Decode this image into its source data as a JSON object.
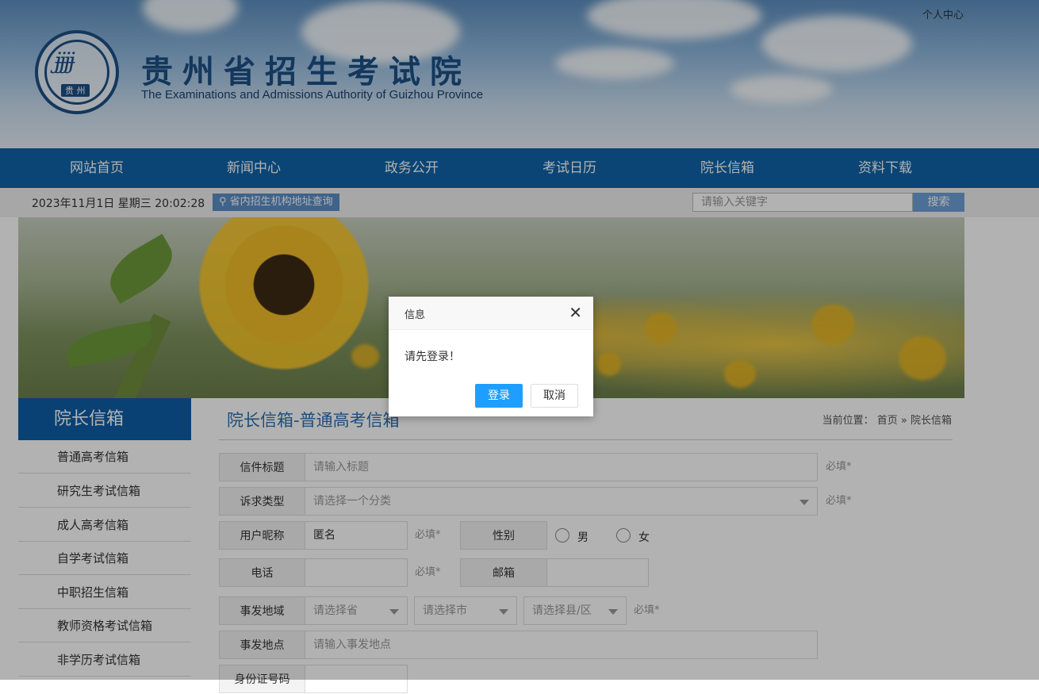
{
  "header": {
    "user_center": "个人中心",
    "site_title": "贵州省招生考试院",
    "site_subtitle": "The Examinations and Admissions Authority of Guizhou Province",
    "logo_text": "贵 州"
  },
  "nav": {
    "items": [
      "网站首页",
      "新闻中心",
      "政务公开",
      "考试日历",
      "院长信箱",
      "资料下载"
    ]
  },
  "infobar": {
    "datetime": "2023年11月1日 星期三 20:02:28",
    "addr_link": "省内招生机构地址查询",
    "search_placeholder": "请输入关键字",
    "search_button": "搜索"
  },
  "sidebar": {
    "heading": "院长信箱",
    "items": [
      "普通高考信箱",
      "研究生考试信箱",
      "成人高考信箱",
      "自学考试信箱",
      "中职招生信箱",
      "教师资格考试信箱",
      "非学历考试信箱"
    ]
  },
  "content": {
    "page_title": "院长信箱-普通高考信箱",
    "breadcrumb": "当前位置： 首页 » 院长信箱",
    "form": {
      "title_label": "信件标题",
      "title_placeholder": "请输入标题",
      "type_label": "诉求类型",
      "type_placeholder": "请选择一个分类",
      "nickname_label": "用户昵称",
      "nickname_value": "匿名",
      "gender_label": "性别",
      "gender_male": "男",
      "gender_female": "女",
      "phone_label": "电话",
      "email_label": "邮箱",
      "region_label": "事发地域",
      "province_placeholder": "请选择省",
      "city_placeholder": "请选择市",
      "county_placeholder": "请选择县/区",
      "place_label": "事发地点",
      "place_placeholder": "请输入事发地点",
      "id_label": "身份证号码",
      "required": "必填*"
    }
  },
  "dialog": {
    "title": "信息",
    "close": "✕",
    "message": "请先登录！",
    "ok": "登录",
    "cancel": "取消"
  }
}
